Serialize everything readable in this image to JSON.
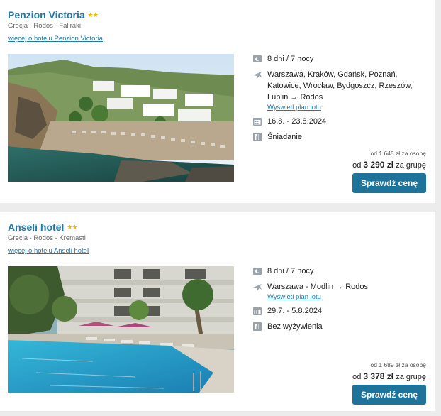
{
  "hotels": [
    {
      "name": "Penzion Victoria",
      "stars": "★★",
      "location": "Grecja - Rodos - Faliraki",
      "more_link": "więcej o hotelu Penzion Victoria",
      "duration": "8 dni / 7 nocy",
      "flights": "Warszawa, Kraków, Gdańsk, Poznań, Katowice, Wrocław, Bydgoszcz, Rzeszów, Lublin → Rodos",
      "flight_plan_link": "Wyświetl plan lotu",
      "dates": "16.8. - 23.8.2024",
      "board": "Śniadanie",
      "price_per_person": "od 1 645 zł za osobę",
      "price_prefix": "od",
      "price_total": "3 290 zł",
      "price_suffix": "za grupę",
      "button": "Sprawdź cenę"
    },
    {
      "name": "Anseli hotel",
      "stars": "★★",
      "location": "Grecja - Rodos - Kremasti",
      "more_link": "więcej o hotelu Anseli hotel",
      "duration": "8 dni / 7 nocy",
      "flights": "Warszawa - Modlin → Rodos",
      "flight_plan_link": "Wyświetl plan lotu",
      "dates": "29.7. - 5.8.2024",
      "board": "Bez wyżywienia",
      "price_per_person": "od 1 689 zł za osobę",
      "price_prefix": "od",
      "price_total": "3 378 zł",
      "price_suffix": "za grupę",
      "button": "Sprawdź cenę"
    }
  ],
  "icons": {
    "duration": "moon-icon",
    "flights": "plane-icon",
    "dates": "calendar-icon",
    "board": "food-icon"
  },
  "colors": {
    "accent": "#1e78a8",
    "button": "#1d7399",
    "stars": "#f4b400",
    "page_bg": "#ececec"
  }
}
